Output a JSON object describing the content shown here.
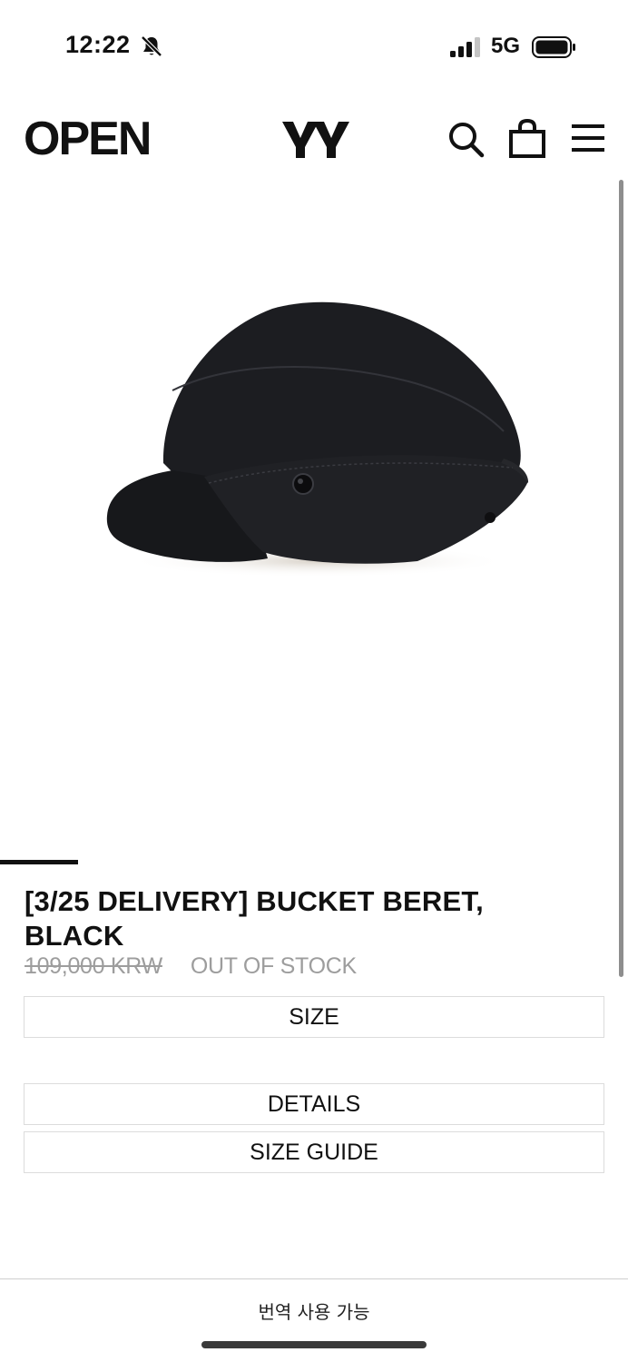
{
  "status_bar": {
    "time": "12:22",
    "network": "5G",
    "icons": [
      "bell-slash-icon",
      "signal-icon",
      "battery-icon"
    ]
  },
  "header": {
    "logo_left": "OPEN",
    "logo_right": "YY",
    "icons": [
      "search-icon",
      "shopping-bag-icon",
      "menu-icon"
    ]
  },
  "product": {
    "title": "[3/25 DELIVERY] BUCKET BERET, BLACK",
    "price": "109,000 KRW",
    "stock_status": "OUT OF STOCK",
    "image_alt": "black bucket beret hat"
  },
  "options": {
    "size_label": "SIZE",
    "details_label": "DETAILS",
    "size_guide_label": "SIZE GUIDE"
  },
  "footer": {
    "translate_text": "번역 사용 가능"
  },
  "colors": {
    "text": "#111111",
    "muted": "#9d9d9d",
    "border": "#dcdcdc"
  }
}
